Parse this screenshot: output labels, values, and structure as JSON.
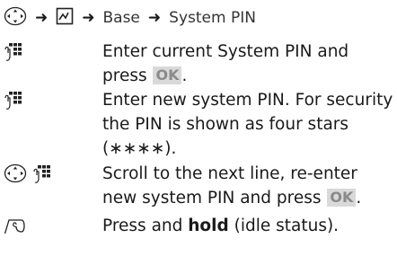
{
  "nav": {
    "crumb_base": "Base",
    "crumb_pin": "System PIN"
  },
  "steps": [
    {
      "text_before": "Enter current System PIN and press ",
      "softkey": "OK",
      "text_after": "."
    },
    {
      "text": "Enter new system PIN. For security the PIN is shown as four stars (∗∗∗∗)."
    },
    {
      "text_before": "Scroll to the next line, re-enter new system PIN and press ",
      "softkey": "OK",
      "text_after": "."
    },
    {
      "text_before": "Press and ",
      "bold": "hold",
      "text_after": " (idle status)."
    }
  ],
  "icons": {
    "nav_key": "navigation-key-icon",
    "menu": "menu-icon",
    "keypad": "keypad-icon",
    "end_call": "end-call-key-icon"
  }
}
